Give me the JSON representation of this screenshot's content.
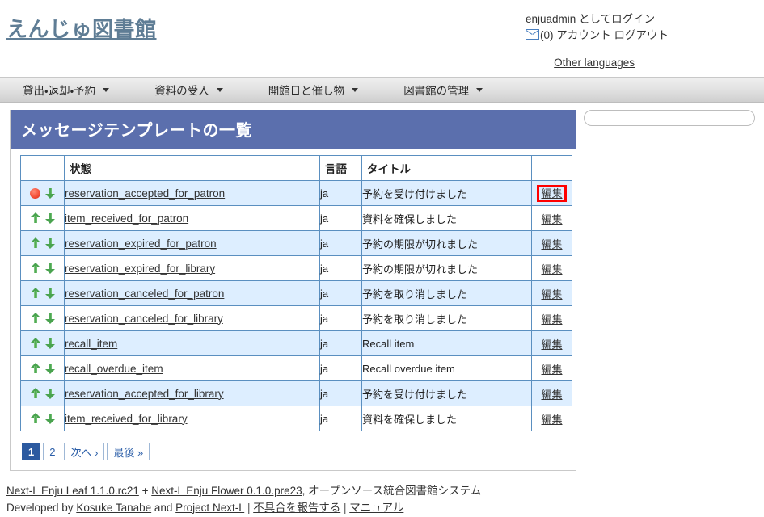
{
  "header": {
    "logo": "えんじゅ図書館",
    "login_status": "enjuadmin としてログイン",
    "mail_icon": "envelope-icon",
    "message_count": "(0)",
    "account_link": "アカウント",
    "logout_link": "ログアウト",
    "other_languages_link": "Other languages"
  },
  "nav": {
    "items": [
      {
        "label": "貸出・返却・予約"
      },
      {
        "label": "資料の受入"
      },
      {
        "label": "開館日と催し物"
      },
      {
        "label": "図書館の管理"
      }
    ]
  },
  "main": {
    "page_title": "メッセージテンプレートの一覧",
    "table": {
      "columns": [
        "",
        "状態",
        "言語",
        "タイトル",
        ""
      ],
      "rows": [
        {
          "move_up_icon": "spinner-red-icon",
          "move_down_icon": "arrow-down-icon",
          "state": "reservation_accepted_for_patron",
          "language": "ja",
          "title": "予約を受け付けました",
          "edit": "編集",
          "highlighted": true
        },
        {
          "move_up_icon": "arrow-up-icon",
          "move_down_icon": "arrow-down-icon",
          "state": "item_received_for_patron",
          "language": "ja",
          "title": "資料を確保しました",
          "edit": "編集",
          "highlighted": false
        },
        {
          "move_up_icon": "arrow-up-icon",
          "move_down_icon": "arrow-down-icon",
          "state": "reservation_expired_for_patron",
          "language": "ja",
          "title": "予約の期限が切れました",
          "edit": "編集",
          "highlighted": false
        },
        {
          "move_up_icon": "arrow-up-icon",
          "move_down_icon": "arrow-down-icon",
          "state": "reservation_expired_for_library",
          "language": "ja",
          "title": "予約の期限が切れました",
          "edit": "編集",
          "highlighted": false
        },
        {
          "move_up_icon": "arrow-up-icon",
          "move_down_icon": "arrow-down-icon",
          "state": "reservation_canceled_for_patron",
          "language": "ja",
          "title": "予約を取り消しました",
          "edit": "編集",
          "highlighted": false
        },
        {
          "move_up_icon": "arrow-up-icon",
          "move_down_icon": "arrow-down-icon",
          "state": "reservation_canceled_for_library",
          "language": "ja",
          "title": "予約を取り消しました",
          "edit": "編集",
          "highlighted": false
        },
        {
          "move_up_icon": "arrow-up-icon",
          "move_down_icon": "arrow-down-icon",
          "state": "recall_item",
          "language": "ja",
          "title": "Recall item",
          "edit": "編集",
          "highlighted": false
        },
        {
          "move_up_icon": "arrow-up-icon",
          "move_down_icon": "arrow-down-icon",
          "state": "recall_overdue_item",
          "language": "ja",
          "title": "Recall overdue item",
          "edit": "編集",
          "highlighted": false
        },
        {
          "move_up_icon": "arrow-up-icon",
          "move_down_icon": "arrow-down-icon",
          "state": "reservation_accepted_for_library",
          "language": "ja",
          "title": "予約を受け付けました",
          "edit": "編集",
          "highlighted": false
        },
        {
          "move_up_icon": "arrow-up-icon",
          "move_down_icon": "arrow-down-icon",
          "state": "item_received_for_library",
          "language": "ja",
          "title": "資料を確保しました",
          "edit": "編集",
          "highlighted": false
        }
      ]
    },
    "pagination": [
      {
        "label": "1",
        "current": true
      },
      {
        "label": "2",
        "current": false
      },
      {
        "label": "次へ ›",
        "current": false
      },
      {
        "label": "最後 »",
        "current": false
      }
    ]
  },
  "sidebar": {
    "search_value": "",
    "search_placeholder": ""
  },
  "footer": {
    "leaf_link": "Next-L Enju Leaf 1.1.0.rc21",
    "plus": " + ",
    "flower_link": "Next-L Enju Flower 0.1.0.pre23",
    "tagline": ", オープンソース統合図書館システム",
    "developed_by": "Developed by ",
    "author_link": "Kosuke Tanabe",
    "and": " and ",
    "project_link": "Project Next-L",
    "sep1": " | ",
    "bug_link": "不具合を報告する",
    "sep2": " | ",
    "manual_link": "マニュアル"
  },
  "colors": {
    "title_bar": "#5b6fad",
    "row_odd": "#ddeeff",
    "table_border": "#5a8fc0",
    "highlight": "#ff0000",
    "pagination_active": "#2c5aa0",
    "arrow_green": "#4aa34f",
    "spinner_red": "#f4513a"
  }
}
